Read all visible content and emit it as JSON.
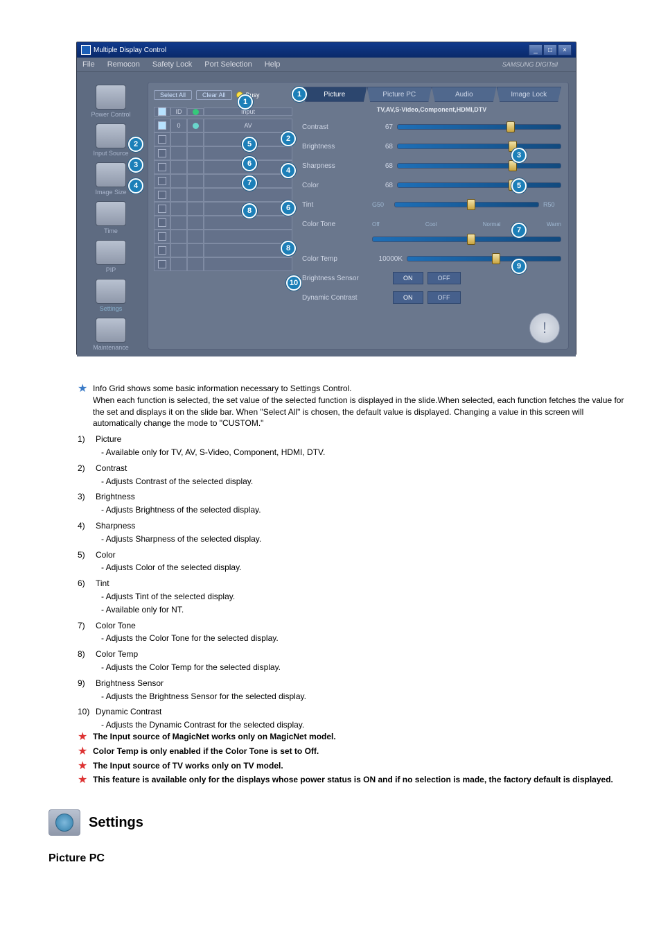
{
  "app": {
    "title": "Multiple Display Control",
    "brand": "SAMSUNG DIGITall",
    "menu": [
      "File",
      "Remocon",
      "Safety Lock",
      "Port Selection",
      "Help"
    ]
  },
  "sidebar": {
    "items": [
      {
        "label": "Power Control"
      },
      {
        "label": "Input Source"
      },
      {
        "label": "Image Size"
      },
      {
        "label": "Time"
      },
      {
        "label": "PIP"
      },
      {
        "label": "Settings"
      },
      {
        "label": "Maintenance"
      }
    ]
  },
  "grid": {
    "select_all": "Select All",
    "clear_all": "Clear All",
    "busy": "Busy",
    "col_input": "Input",
    "rows": [
      {
        "id": "0",
        "input": "AV",
        "on": true
      },
      {
        "id": "",
        "input": "",
        "on": false
      },
      {
        "id": "",
        "input": "",
        "on": false
      },
      {
        "id": "",
        "input": "",
        "on": false
      },
      {
        "id": "",
        "input": "",
        "on": false
      },
      {
        "id": "",
        "input": "",
        "on": false
      },
      {
        "id": "",
        "input": "",
        "on": false
      },
      {
        "id": "",
        "input": "",
        "on": false
      },
      {
        "id": "",
        "input": "",
        "on": false
      },
      {
        "id": "",
        "input": "",
        "on": false
      },
      {
        "id": "",
        "input": "",
        "on": false
      }
    ]
  },
  "tabs": [
    "Picture",
    "Picture PC",
    "Audio",
    "Image Lock"
  ],
  "panel": {
    "sub": "TV,AV,S-Video,Component,HDMI,DTV",
    "contrast": {
      "label": "Contrast",
      "value": "67"
    },
    "brightness": {
      "label": "Brightness",
      "value": "68"
    },
    "sharpness": {
      "label": "Sharpness",
      "value": "68"
    },
    "color": {
      "label": "Color",
      "value": "68"
    },
    "tint": {
      "label": "Tint",
      "g": "G50",
      "r": "R50"
    },
    "tone": {
      "label": "Color Tone",
      "opts": [
        "Off",
        "Cool",
        "Normal",
        "Warm"
      ]
    },
    "temp": {
      "label": "Color Temp",
      "value": "10000K"
    },
    "bsensor": {
      "label": "Brightness Sensor",
      "on": "ON",
      "off": "OFF"
    },
    "dcontrast": {
      "label": "Dynamic Contrast",
      "on": "ON",
      "off": "OFF"
    }
  },
  "notes": {
    "intro": "Info Grid shows some basic information necessary to Settings Control.",
    "intro2": "When each function is selected, the set value of the selected function is displayed in the slide.When selected, each function fetches the value for the set and displays it on the slide bar. When \"Select All\" is chosen, the default value is displayed. Changing a value in this screen will automatically change the mode to \"CUSTOM.\"",
    "items": [
      {
        "n": "1)",
        "t": "Picture",
        "s": [
          "- Available only for TV, AV, S-Video, Component, HDMI, DTV."
        ]
      },
      {
        "n": "2)",
        "t": "Contrast",
        "s": [
          "- Adjusts Contrast of the selected display."
        ]
      },
      {
        "n": "3)",
        "t": "Brightness",
        "s": [
          "- Adjusts Brightness of the selected display."
        ]
      },
      {
        "n": "4)",
        "t": "Sharpness",
        "s": [
          "- Adjusts Sharpness of the selected display."
        ]
      },
      {
        "n": "5)",
        "t": "Color",
        "s": [
          "- Adjusts Color of the selected display."
        ]
      },
      {
        "n": "6)",
        "t": "Tint",
        "s": [
          "- Adjusts Tint of the selected display.",
          "- Available  only for NT."
        ]
      },
      {
        "n": "7)",
        "t": "Color Tone",
        "s": [
          "- Adjusts the Color Tone for the selected display."
        ]
      },
      {
        "n": "8)",
        "t": "Color Temp",
        "s": [
          "- Adjusts the Color Temp for the selected display."
        ]
      },
      {
        "n": "9)",
        "t": "Brightness Sensor",
        "s": [
          "- Adjusts the Brightness Sensor for the selected display."
        ]
      },
      {
        "n": "10)",
        "t": "Dynamic Contrast",
        "s": [
          "- Adjusts the Dynamic Contrast for the selected display."
        ]
      }
    ],
    "stars": [
      "The Input source of MagicNet works only on MagicNet model.",
      "Color Temp is only enabled if the Color Tone is set to Off.",
      "The Input source of TV works only on TV model.",
      "This feature is available only for the displays whose power status is ON and if no selection is made, the factory default is displayed."
    ]
  },
  "footer": {
    "settings": "Settings",
    "picturepc": "Picture PC"
  }
}
